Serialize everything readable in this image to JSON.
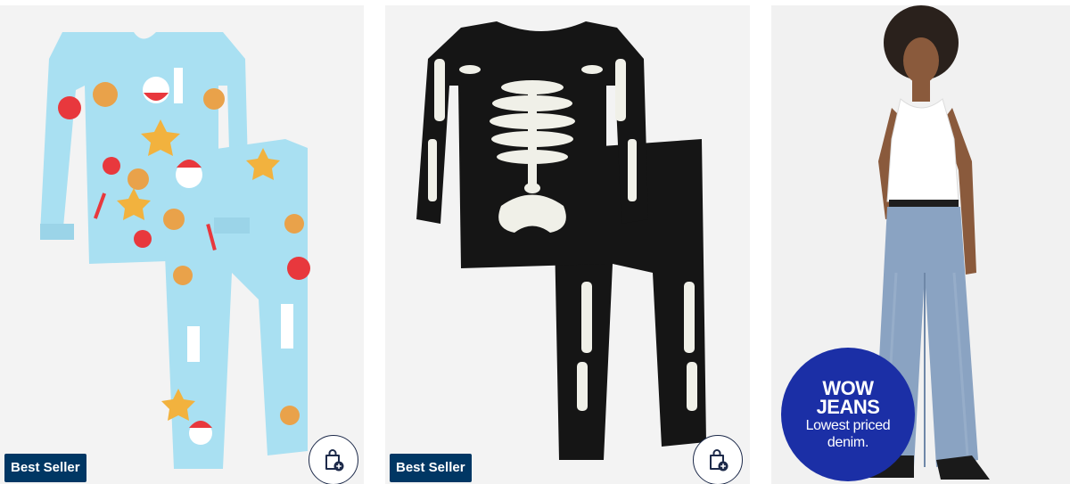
{
  "products": [
    {
      "image_alt": "Toddler holiday pajama set",
      "badge": "Best Seller",
      "quick_add_icon": "shopping-bag-plus-icon"
    },
    {
      "image_alt": "Toddler skeleton pajama set",
      "badge": "Best Seller",
      "quick_add_icon": "shopping-bag-plus-icon"
    },
    {
      "image_alt": "Woman in wide-leg jeans and white tank top"
    }
  ],
  "promo": {
    "line1": "WOW",
    "line2": "JEANS",
    "line3": "Lowest priced",
    "line4": "denim."
  },
  "colors": {
    "card_bg": "#f3f3f3",
    "badge_bg": "#003764",
    "promo_bg": "#1b2fa6",
    "pajama_blue": "#a9e0f2",
    "pajama_black": "#151515",
    "denim": "#8aa3c2"
  }
}
